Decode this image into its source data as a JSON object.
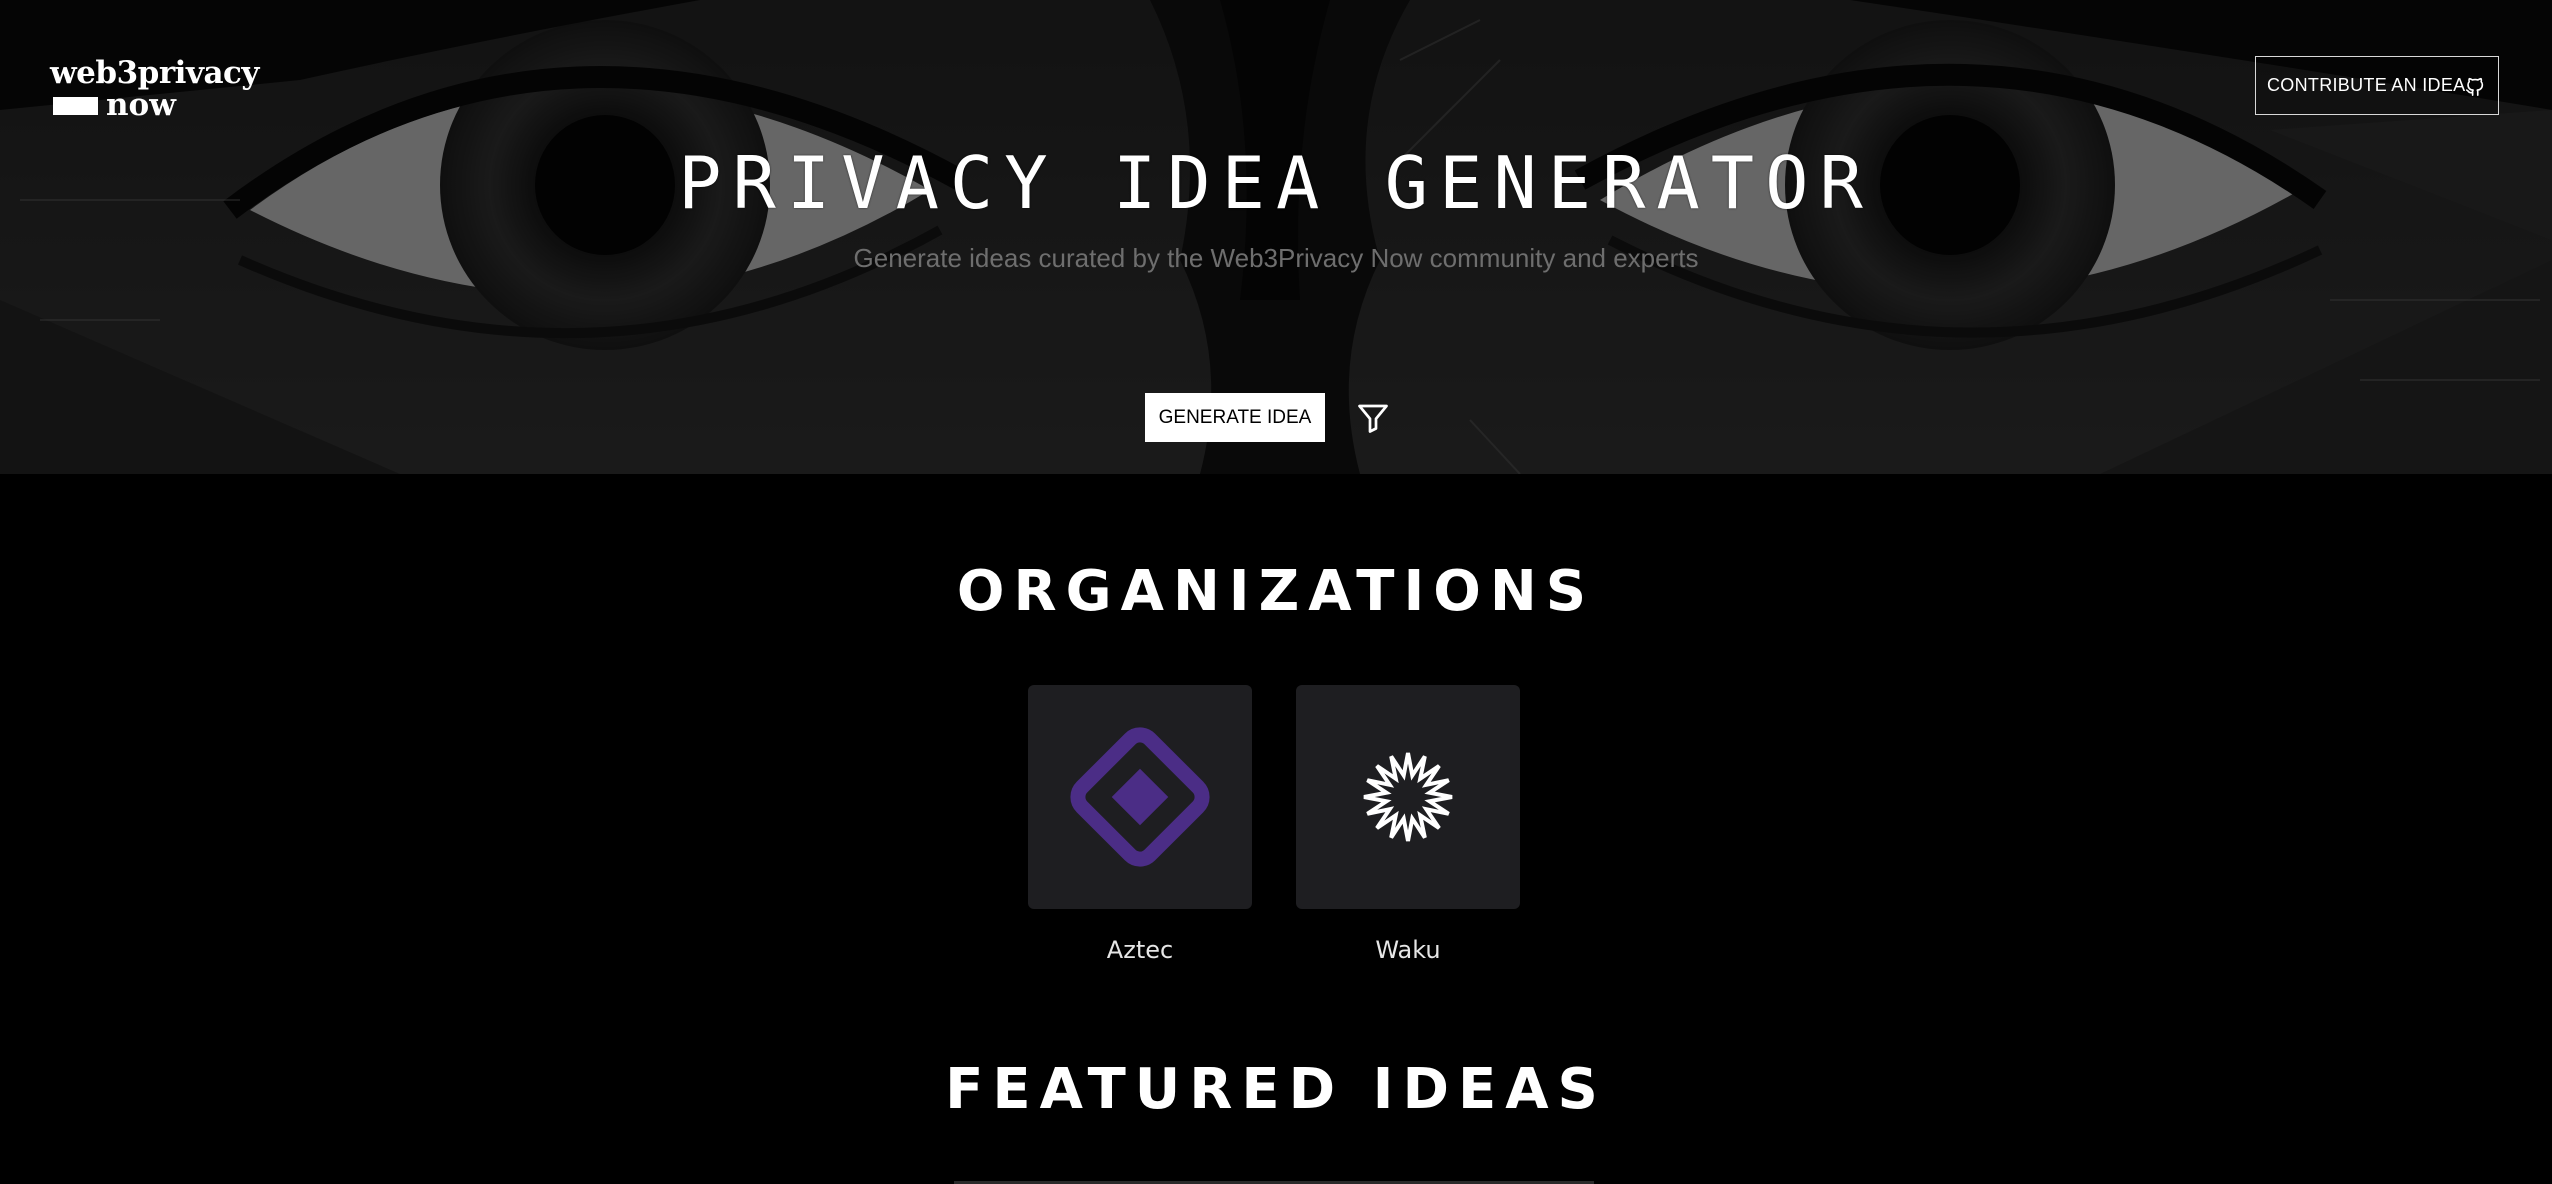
{
  "header": {
    "logo_line1": "web3privacy",
    "logo_line2": "now",
    "contribute_label": "CONTRIBUTE AN IDEA",
    "contribute_icon": "github-icon"
  },
  "hero": {
    "title": "PRIVACY IDEA GENERATOR",
    "subtitle": "Generate ideas curated by the Web3Privacy Now community and experts",
    "generate_label": "GENERATE IDEA",
    "filter_icon": "filter-icon"
  },
  "organizations": {
    "heading": "ORGANIZATIONS",
    "items": [
      {
        "name": "Aztec",
        "icon": "aztec-diamond-icon",
        "color": "#4b2d86"
      },
      {
        "name": "Waku",
        "icon": "waku-starburst-icon",
        "color": "#ffffff"
      }
    ]
  },
  "featured": {
    "heading": "FEATURED IDEAS"
  },
  "colors": {
    "background": "#000000",
    "card": "#1e1e21",
    "subtitle": "#6e6e6e",
    "button_bg": "#ffffff"
  }
}
